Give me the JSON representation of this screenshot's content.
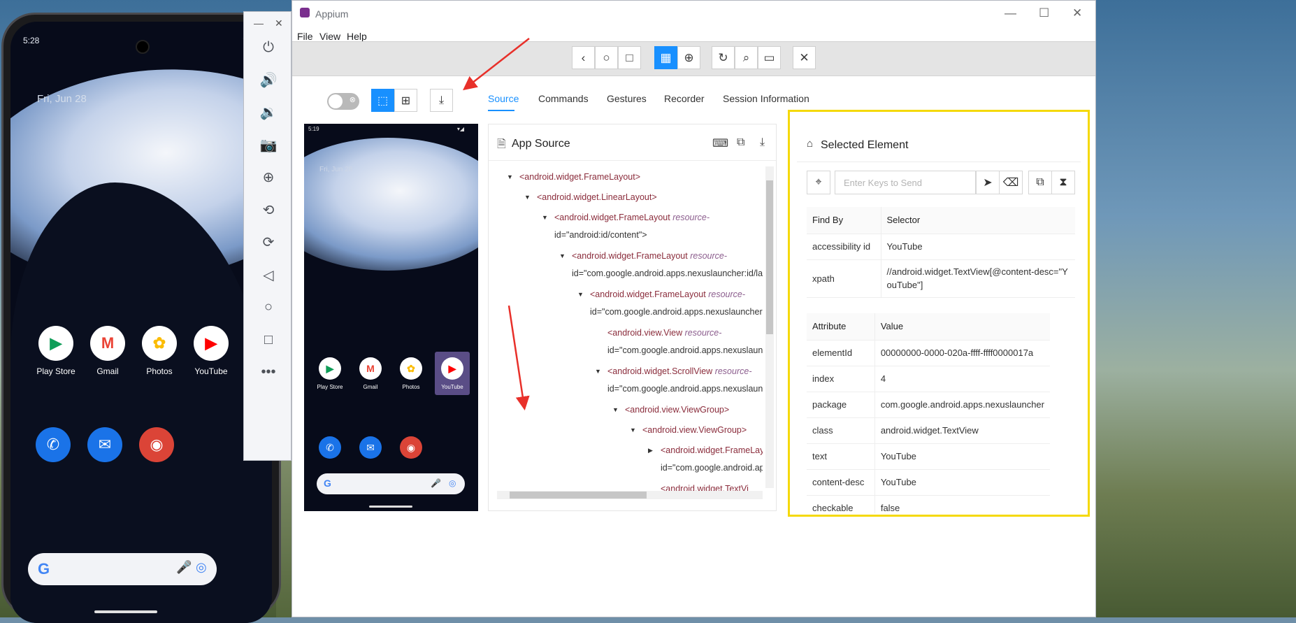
{
  "phone": {
    "time": "5:28",
    "date": "Fri, Jun 28",
    "apps": [
      {
        "label": "Play Store",
        "glyph": "▶",
        "color": "#0f9d58"
      },
      {
        "label": "Gmail",
        "glyph": "M",
        "color": "#ea4335"
      },
      {
        "label": "Photos",
        "glyph": "✿",
        "color": "#fbbc04"
      },
      {
        "label": "YouTube",
        "glyph": "▶",
        "color": "#ff0000"
      }
    ],
    "dock": [
      {
        "name": "phone-app-icon",
        "glyph": "✆",
        "color": "#1a73e8"
      },
      {
        "name": "messages-app-icon",
        "glyph": "✉",
        "color": "#1a73e8"
      },
      {
        "name": "chrome-app-icon",
        "glyph": "◉",
        "color": "#db4437"
      }
    ],
    "search_g": "G"
  },
  "window": {
    "title": "Appium",
    "menu": [
      "File",
      "View",
      "Help"
    ],
    "min": "—",
    "max": "☐",
    "close": "✕"
  },
  "toolbar": {
    "back": "‹",
    "home": "○",
    "recent": "□",
    "native_mode": "▦",
    "web_mode": "⊕",
    "refresh": "↻",
    "search": "⌕",
    "record": "▭",
    "quit": "✕"
  },
  "tabs": [
    "Source",
    "Commands",
    "Gestures",
    "Recorder",
    "Session Information"
  ],
  "screenshot": {
    "time": "5:19",
    "date": "Fri, Jun 28",
    "apps": [
      {
        "label": "Play Store",
        "glyph": "▶",
        "color": "#0f9d58"
      },
      {
        "label": "Gmail",
        "glyph": "M",
        "color": "#ea4335"
      },
      {
        "label": "Photos",
        "glyph": "✿",
        "color": "#fbbc04"
      },
      {
        "label": "YouTube",
        "glyph": "▶",
        "color": "#ff0000"
      }
    ]
  },
  "source": {
    "title": "App Source",
    "nodes": [
      {
        "tag": "<android.widget.FrameLayout>",
        "attr": "",
        "cont": "",
        "expanded": true
      },
      {
        "tag": "<android.widget.LinearLayout>",
        "attr": "",
        "cont": "",
        "expanded": true
      },
      {
        "tag": "<android.widget.FrameLayout",
        "attr": "resource-",
        "cont": "id=\"android:id/content\">",
        "expanded": true
      },
      {
        "tag": "<android.widget.FrameLayout",
        "attr": "resource-",
        "cont": "id=\"com.google.android.apps.nexuslauncher:id/la",
        "expanded": true
      },
      {
        "tag": "<android.widget.FrameLayout",
        "attr": "resource-",
        "cont": "id=\"com.google.android.apps.nexuslauncher:",
        "expanded": true
      },
      {
        "tag": "<android.view.View",
        "attr": "resource-",
        "cont": "id=\"com.google.android.apps.nexuslaun",
        "expanded": null
      },
      {
        "tag": "<android.widget.ScrollView",
        "attr": "resource-",
        "cont": "id=\"com.google.android.apps.nexuslaun",
        "expanded": true
      },
      {
        "tag": "<android.view.ViewGroup>",
        "attr": "",
        "cont": "",
        "expanded": true
      },
      {
        "tag": "<android.view.ViewGroup>",
        "attr": "",
        "cont": "",
        "expanded": true
      },
      {
        "tag": "<android.widget.FrameLay",
        "attr": "",
        "cont": "id=\"com.google.android.ap",
        "expanded": false
      },
      {
        "tag": "<android.widget.TextVi",
        "attr": "",
        "cont": "",
        "expanded": null
      }
    ]
  },
  "selected": {
    "title": "Selected Element",
    "keys_placeholder": "Enter Keys to Send",
    "find_header": [
      "Find By",
      "Selector"
    ],
    "find_rows": [
      [
        "accessibility id",
        "YouTube"
      ],
      [
        "xpath",
        "//android.widget.TextView[@content-desc=\"YouTube\"]"
      ]
    ],
    "attr_header": [
      "Attribute",
      "Value"
    ],
    "attr_rows": [
      [
        "elementId",
        "00000000-0000-020a-ffff-ffff0000017a"
      ],
      [
        "index",
        "4"
      ],
      [
        "package",
        "com.google.android.apps.nexuslauncher"
      ],
      [
        "class",
        "android.widget.TextView"
      ],
      [
        "text",
        "YouTube"
      ],
      [
        "content-desc",
        "YouTube"
      ],
      [
        "checkable",
        "false"
      ]
    ]
  },
  "colors": {
    "accent": "#1890ff",
    "highlight": "#f5d90a",
    "annotation": "#e8302a"
  }
}
